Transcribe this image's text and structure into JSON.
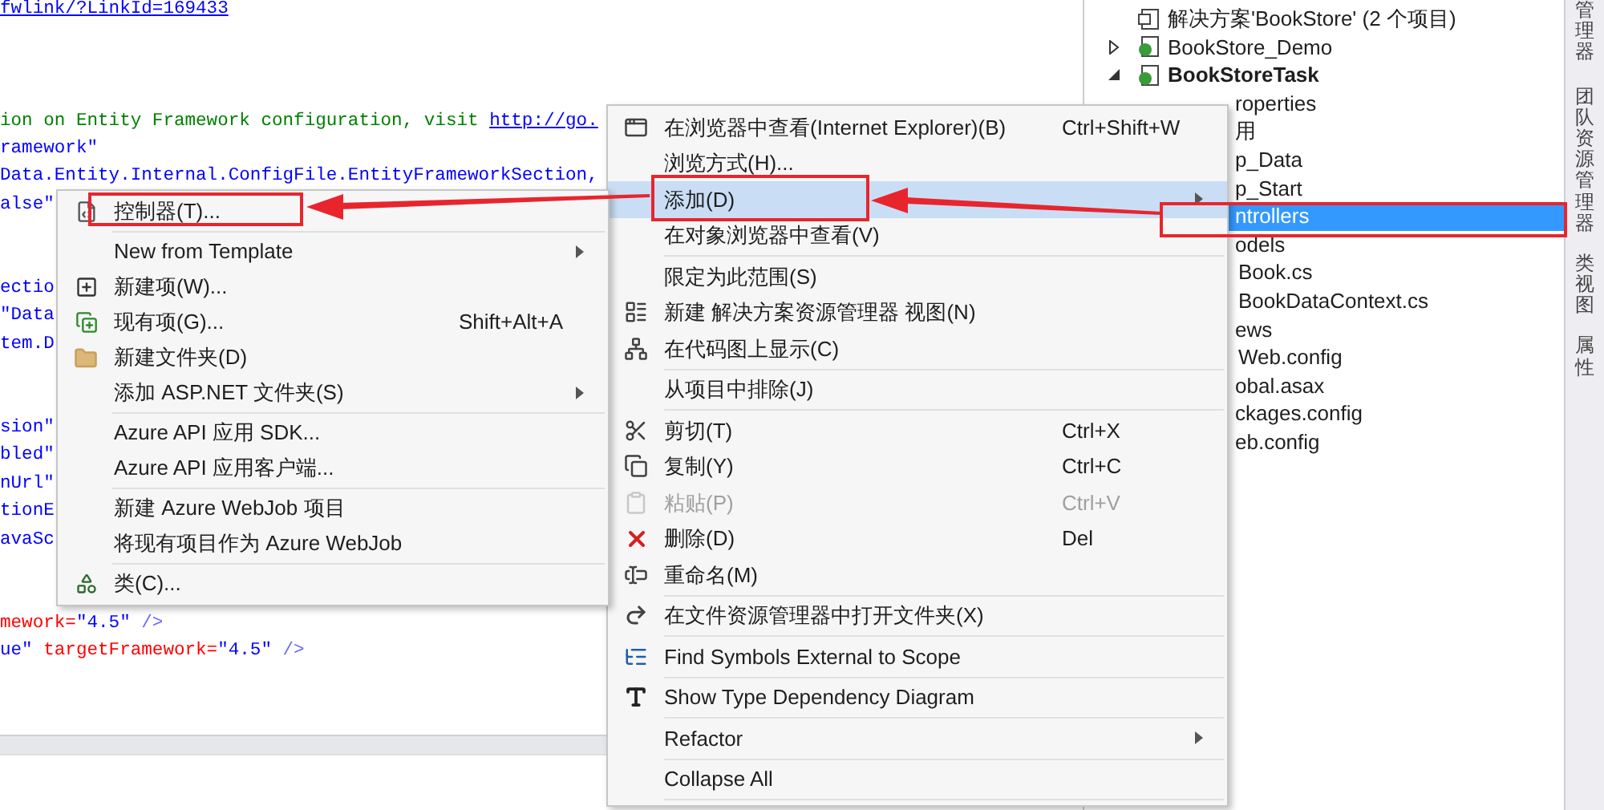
{
  "editor": {
    "lines": [
      {
        "segments": [
          {
            "kind": "link",
            "text": "fwlink/?LinkId=169433"
          }
        ]
      },
      {
        "segments": [
          {
            "kind": "comment",
            "text": "ion on Entity Framework configuration, visit "
          },
          {
            "kind": "link",
            "text": "http://go."
          }
        ]
      },
      {
        "segments": [
          {
            "kind": "string",
            "text": "ramework\""
          }
        ]
      },
      {
        "segments": [
          {
            "kind": "string",
            "text": "Data.Entity.Internal.ConfigFile.EntityFrameworkSection,"
          }
        ]
      },
      {
        "segments": [
          {
            "kind": "string",
            "text": "alse\""
          }
        ]
      },
      {
        "segments": [
          {
            "kind": "string",
            "text": "ectio"
          }
        ]
      },
      {
        "segments": [
          {
            "kind": "string",
            "text": "\"Data"
          }
        ]
      },
      {
        "segments": [
          {
            "kind": "string",
            "text": "tem.D"
          }
        ]
      },
      {
        "segments": [
          {
            "kind": "string",
            "text": "sion\""
          }
        ]
      },
      {
        "segments": [
          {
            "kind": "string",
            "text": "bled\""
          }
        ]
      },
      {
        "segments": [
          {
            "kind": "string",
            "text": "nUrl\""
          }
        ]
      },
      {
        "segments": [
          {
            "kind": "string",
            "text": "tionE"
          }
        ]
      },
      {
        "segments": [
          {
            "kind": "string",
            "text": "avaSc"
          }
        ]
      },
      {
        "segments": [
          {
            "kind": "attr",
            "text": "mework="
          },
          {
            "kind": "string",
            "text": "\"4.5\""
          },
          {
            "kind": "punct",
            "text": " />"
          }
        ]
      },
      {
        "segments": [
          {
            "kind": "string",
            "text": "ue\""
          },
          {
            "kind": "attr",
            "text": " targetFramework="
          },
          {
            "kind": "string",
            "text": "\"4.5\""
          },
          {
            "kind": "punct",
            "text": " />"
          }
        ]
      }
    ]
  },
  "solution_explorer": {
    "tree": [
      {
        "label": "解决方案'BookStore' (2 个项目)",
        "bold": false,
        "selected": false,
        "children": [
          {
            "label": "BookStore_Demo",
            "bold": false,
            "selected": false,
            "expanded": false
          },
          {
            "label": "BookStoreTask",
            "bold": true,
            "selected": false,
            "expanded": true,
            "children": [
              {
                "label": "roperties",
                "bold": false,
                "selected": false
              },
              {
                "label": "用",
                "bold": false,
                "selected": false
              },
              {
                "label": "p_Data",
                "bold": false,
                "selected": false
              },
              {
                "label": "p_Start",
                "bold": false,
                "selected": false
              },
              {
                "label": "ntrollers",
                "bold": false,
                "selected": true
              },
              {
                "label": "odels",
                "bold": false,
                "selected": false,
                "children": [
                  {
                    "label": "Book.cs",
                    "bold": false,
                    "selected": false
                  },
                  {
                    "label": "BookDataContext.cs",
                    "bold": false,
                    "selected": false
                  }
                ]
              },
              {
                "label": "ews",
                "bold": false,
                "selected": false,
                "children": [
                  {
                    "label": "Web.config",
                    "bold": false,
                    "selected": false
                  }
                ]
              },
              {
                "label": "obal.asax",
                "bold": false,
                "selected": false
              },
              {
                "label": "ckages.config",
                "bold": false,
                "selected": false
              },
              {
                "label": "eb.config",
                "bold": false,
                "selected": false
              }
            ]
          }
        ]
      }
    ]
  },
  "side_tabs": [
    "管理器",
    "团队资源管理器",
    "类视图",
    "属性"
  ],
  "context_menu": {
    "items": [
      {
        "kind": "item",
        "label": "在浏览器中查看(Internet Explorer)(B)",
        "shortcut": "Ctrl+Shift+W",
        "selected": false,
        "disabled": false,
        "submenu": false
      },
      {
        "kind": "item",
        "label": "浏览方式(H)...",
        "selected": false,
        "disabled": false,
        "submenu": false
      },
      {
        "kind": "item",
        "label": "添加(D)",
        "selected": true,
        "disabled": false,
        "submenu": true
      },
      {
        "kind": "item",
        "label": "在对象浏览器中查看(V)",
        "selected": false,
        "disabled": false,
        "submenu": false
      },
      {
        "kind": "separator"
      },
      {
        "kind": "item",
        "label": "限定为此范围(S)",
        "selected": false,
        "disabled": false,
        "submenu": false
      },
      {
        "kind": "item",
        "label": "新建 解决方案资源管理器 视图(N)",
        "selected": false,
        "disabled": false,
        "submenu": false
      },
      {
        "kind": "item",
        "label": "在代码图上显示(C)",
        "selected": false,
        "disabled": false,
        "submenu": false
      },
      {
        "kind": "separator"
      },
      {
        "kind": "item",
        "label": "从项目中排除(J)",
        "selected": false,
        "disabled": false,
        "submenu": false
      },
      {
        "kind": "separator"
      },
      {
        "kind": "item",
        "label": "剪切(T)",
        "shortcut": "Ctrl+X",
        "selected": false,
        "disabled": false,
        "submenu": false
      },
      {
        "kind": "item",
        "label": "复制(Y)",
        "shortcut": "Ctrl+C",
        "selected": false,
        "disabled": false,
        "submenu": false
      },
      {
        "kind": "item",
        "label": "粘贴(P)",
        "shortcut": "Ctrl+V",
        "selected": false,
        "disabled": true,
        "submenu": false
      },
      {
        "kind": "item",
        "label": "删除(D)",
        "shortcut": "Del",
        "selected": false,
        "disabled": false,
        "submenu": false
      },
      {
        "kind": "item",
        "label": "重命名(M)",
        "selected": false,
        "disabled": false,
        "submenu": false
      },
      {
        "kind": "separator"
      },
      {
        "kind": "item",
        "label": "在文件资源管理器中打开文件夹(X)",
        "selected": false,
        "disabled": false,
        "submenu": false
      },
      {
        "kind": "separator"
      },
      {
        "kind": "item",
        "label": "Find Symbols External to Scope",
        "selected": false,
        "disabled": false,
        "submenu": false
      },
      {
        "kind": "separator"
      },
      {
        "kind": "item",
        "label": "Show Type Dependency Diagram",
        "selected": false,
        "disabled": false,
        "submenu": false
      },
      {
        "kind": "separator"
      },
      {
        "kind": "item",
        "label": "Refactor",
        "selected": false,
        "disabled": false,
        "submenu": true
      },
      {
        "kind": "separator"
      },
      {
        "kind": "item",
        "label": "Collapse All",
        "selected": false,
        "disabled": false,
        "submenu": false
      },
      {
        "kind": "separator"
      }
    ]
  },
  "add_submenu": {
    "items": [
      {
        "kind": "item",
        "label": "控制器(T)...",
        "selected": false,
        "submenu": false
      },
      {
        "kind": "separator"
      },
      {
        "kind": "item",
        "label": "New from Template",
        "selected": false,
        "submenu": true
      },
      {
        "kind": "item",
        "label": "新建项(W)...",
        "selected": false,
        "submenu": false
      },
      {
        "kind": "item",
        "label": "现有项(G)...",
        "shortcut": "Shift+Alt+A",
        "selected": false,
        "submenu": false
      },
      {
        "kind": "item",
        "label": "新建文件夹(D)",
        "selected": false,
        "submenu": false
      },
      {
        "kind": "item",
        "label": "添加 ASP.NET 文件夹(S)",
        "selected": false,
        "submenu": true
      },
      {
        "kind": "separator"
      },
      {
        "kind": "item",
        "label": "Azure API 应用 SDK...",
        "selected": false,
        "submenu": false
      },
      {
        "kind": "item",
        "label": "Azure API 应用客户端...",
        "selected": false,
        "submenu": false
      },
      {
        "kind": "separator"
      },
      {
        "kind": "item",
        "label": "新建 Azure WebJob 项目",
        "selected": false,
        "submenu": false
      },
      {
        "kind": "item",
        "label": "将现有项目作为 Azure WebJob",
        "selected": false,
        "submenu": false
      },
      {
        "kind": "separator"
      },
      {
        "kind": "item",
        "label": "类(C)...",
        "selected": false,
        "submenu": false
      }
    ]
  }
}
